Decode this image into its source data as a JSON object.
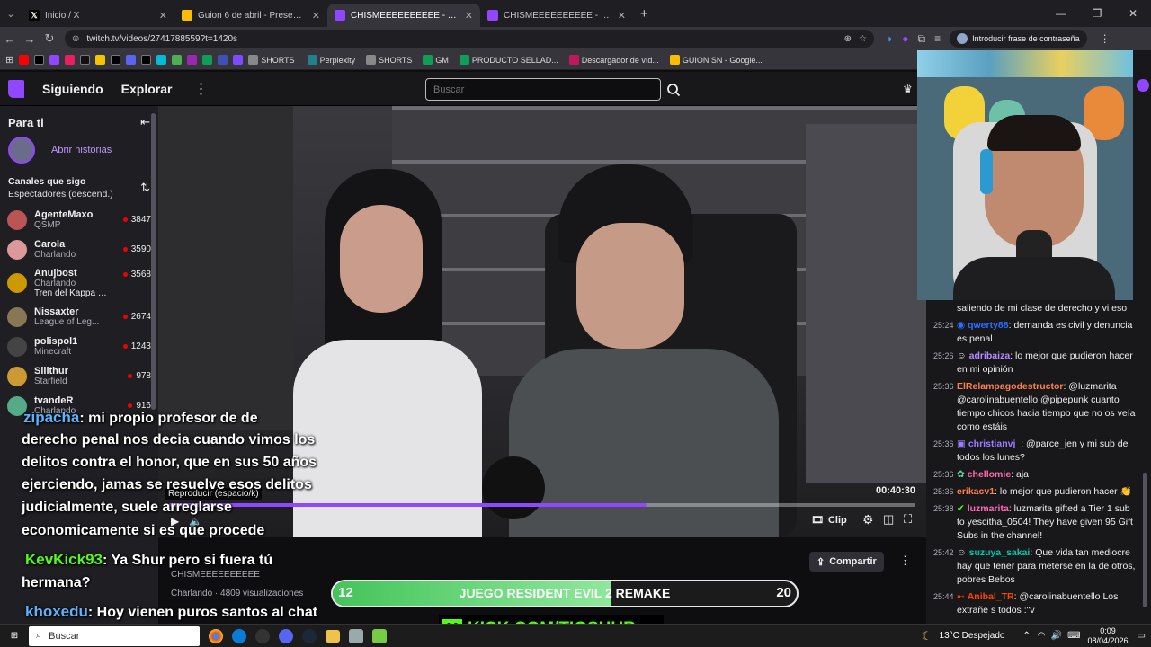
{
  "browser": {
    "tabs": [
      {
        "icon": "X",
        "title": "Inicio / X",
        "color": "#000"
      },
      {
        "icon": "G",
        "title": "Guion 6 de abril - Presentacion...",
        "color": "#fbbc04"
      },
      {
        "icon": "T",
        "title": "CHISMEEEEEEEEEE - Twitch",
        "color": "#9147ff",
        "active": true
      },
      {
        "icon": "T",
        "title": "CHISMEEEEEEEEEE - Twitch",
        "color": "#9147ff"
      }
    ],
    "url": "twitch.tv/videos/2741788559?t=1420s",
    "password_prompt": "Introducir frase de contraseña",
    "bookmarks": [
      {
        "label": "SHORTS",
        "color": "#888"
      },
      {
        "label": "Perplexity",
        "color": "#20808d"
      },
      {
        "label": "SHORTS",
        "color": "#888"
      },
      {
        "label": "GM",
        "color": "#0f9d58"
      },
      {
        "label": "PRODUCTO SELLAD...",
        "color": "#0f9d58"
      },
      {
        "label": "Descargador de víd...",
        "color": "#c2185b"
      },
      {
        "label": "GUION SN - Google...",
        "color": "#fbbc04"
      }
    ]
  },
  "twitch": {
    "nav": {
      "following": "Siguiendo",
      "explore": "Explorar",
      "search_placeholder": "Buscar"
    },
    "sidebar": {
      "for_you": "Para ti",
      "stories": "Abrir historias",
      "following_channels": "Canales que sigo",
      "sort": "Espectadores (descend.)",
      "channels": [
        {
          "name": "AgenteMaxo",
          "game": "QSMP",
          "viewers": "3847",
          "color": "#b55"
        },
        {
          "name": "Carola",
          "game": "Charlando",
          "viewers": "3590",
          "color": "#d99"
        },
        {
          "name": "Anujbost",
          "game": "Charlando",
          "viewers": "3568",
          "color": "#c90",
          "extra": "Tren del Kappa dora..."
        },
        {
          "name": "Nissaxter",
          "game": "League of Leg...",
          "viewers": "2674",
          "color": "#875"
        },
        {
          "name": "polispol1",
          "game": "Minecraft",
          "viewers": "1243",
          "color": "#444"
        },
        {
          "name": "Silithur",
          "game": "Starfield",
          "viewers": "978",
          "color": "#c93"
        },
        {
          "name": "tvandeR",
          "game": "Charlando",
          "viewers": "916",
          "color": "#5a8"
        }
      ]
    },
    "video": {
      "tooltip": "Reproducir (espacio/k)",
      "time": "00:40:30",
      "clip": "Clip",
      "title": "CHISMEEEEEEEEEE",
      "meta": "Charlando · 4809 visualizaciones",
      "share": "Compartir",
      "progress_fraction": 0.64
    },
    "overlay_chat": [
      {
        "user": "zipacha",
        "color": "#5ab4ff",
        "text": ": mi propio profesor de de"
      },
      {
        "text": "derecho penal nos decia cuando vimos los"
      },
      {
        "text": "delitos contra el honor, que en sus 50 años"
      },
      {
        "text": "ejerciendo, jamas se resuelve esos delitos"
      },
      {
        "text": "judicialmente, suele arreglarse"
      },
      {
        "text": "economicamente si es que procede"
      },
      {
        "user": "KevKick93",
        "color": "#53fc18",
        "text": ": Ya Shur pero si fuera tú"
      },
      {
        "text": "hermana?"
      },
      {
        "user": "khoxedu",
        "color": "#5ab4ff",
        "text": ": Hoy vienen puros santos al chat"
      }
    ],
    "goal_bar": {
      "left": "12",
      "label": "JUEGO RESIDENT EVIL 2 REMAKE",
      "right": "20",
      "fraction": 0.6
    },
    "kick_banner": "KICK.COM/TIOSHUR",
    "chat": [
      {
        "time": "",
        "user": "",
        "color": "#efeff1",
        "text": "saliendo de mi clase de derecho y vi eso"
      },
      {
        "time": "25:24",
        "user": "qwerty88",
        "color": "#2e6cff",
        "text": ": demanda es civil y denuncia es penal"
      },
      {
        "time": "25:26",
        "user": "adribaiza",
        "color": "#b98cff",
        "text": ": lo mejor que pudieron hacer en mi opinión"
      },
      {
        "time": "25:36",
        "user": "ElRelampagodestructor",
        "color": "#ff7f50",
        "text": ": @luzmarita @carolinabuentello @pipepunk cuanto tiempo chicos hacia tiempo que no os veía como estáis"
      },
      {
        "time": "25:36",
        "user": "christianvj_",
        "color": "#9b7cff",
        "text": ": @parce_jen y mi sub de todos los lunes?"
      },
      {
        "time": "25:36",
        "user": "chellomie",
        "color": "#ff69b4",
        "text": ": aja"
      },
      {
        "time": "25:36",
        "user": "erikacv1",
        "color": "#ff7f50",
        "text": ": lo mejor que pudieron hacer 👏"
      },
      {
        "time": "25:38",
        "user": "luzmarita",
        "color": "#ff69b4",
        "text": ": luzmarita gifted a Tier 1 sub to yescitha_0504! They have given 95 Gift Subs in the channel!"
      },
      {
        "time": "25:42",
        "user": "suzuya_sakai",
        "color": "#00c8af",
        "text": ": Que vida tan mediocre hay que tener para meterse en la de otros, pobres Bebos"
      },
      {
        "time": "25:44",
        "user": "Anibal_TR",
        "color": "#ff4500",
        "text": ": @carolinabuentello Los extrañe s todos :\"v"
      }
    ]
  },
  "taskbar": {
    "search": "Buscar",
    "weather": "13°C  Despejado",
    "time": "0:09",
    "date": "08/04/2026"
  }
}
